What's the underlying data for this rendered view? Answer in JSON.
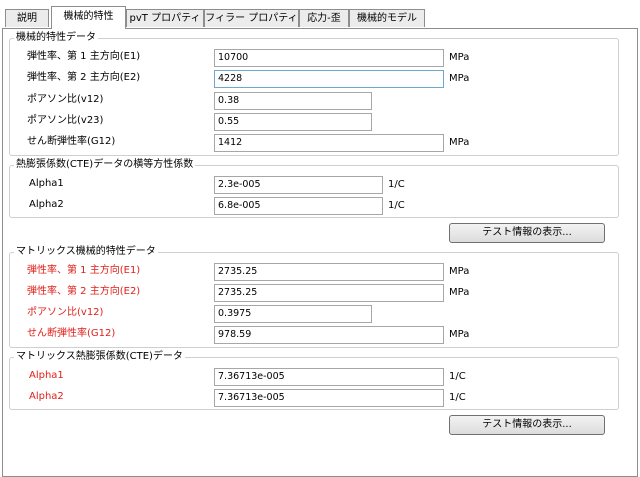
{
  "tabs": [
    {
      "label": "説明"
    },
    {
      "label": "機械的特性"
    },
    {
      "label": "pvT プロパティ"
    },
    {
      "label": "フィラー プロパティ"
    },
    {
      "label": "応力-歪"
    },
    {
      "label": "機械的モデル"
    }
  ],
  "mech": {
    "title": "機械的特性データ",
    "rows": [
      {
        "label": "弾性率、第 1 主方向(E1)",
        "value": "10700",
        "unit": "MPa"
      },
      {
        "label": "弾性率、第 2 主方向(E2)",
        "value": "4228",
        "unit": "MPa"
      },
      {
        "label": "ポアソン比(v12)",
        "value": "0.38"
      },
      {
        "label": "ポアソン比(v23)",
        "value": "0.55"
      },
      {
        "label": "せん断弾性率(G12)",
        "value": "1412",
        "unit": "MPa"
      }
    ]
  },
  "cte": {
    "title": "熱膨張係数(CTE)データの横等方性係数",
    "rows": [
      {
        "label": "Alpha1",
        "value": "2.3e-005",
        "unit": "1/C"
      },
      {
        "label": "Alpha2",
        "value": "6.8e-005",
        "unit": "1/C"
      }
    ],
    "button": "テスト情報の表示..."
  },
  "matrix_mech": {
    "title": "マトリックス機械的特性データ",
    "rows": [
      {
        "label": "弾性率、第 1 主方向(E1)",
        "value": "2735.25",
        "unit": "MPa"
      },
      {
        "label": "弾性率、第 2 主方向(E2)",
        "value": "2735.25",
        "unit": "MPa"
      },
      {
        "label": "ポアソン比(v12)",
        "value": "0.3975"
      },
      {
        "label": "せん断弾性率(G12)",
        "value": "978.59",
        "unit": "MPa"
      }
    ]
  },
  "matrix_cte": {
    "title": "マトリックス熱膨張係数(CTE)データ",
    "rows": [
      {
        "label": "Alpha1",
        "value": "7.36713e-005",
        "unit": "1/C"
      },
      {
        "label": "Alpha2",
        "value": "7.36713e-005",
        "unit": "1/C"
      }
    ],
    "button": "テスト情報の表示..."
  },
  "colors": {
    "highlight_label": "#e0201a",
    "focus_border": "#6fa7d1"
  }
}
